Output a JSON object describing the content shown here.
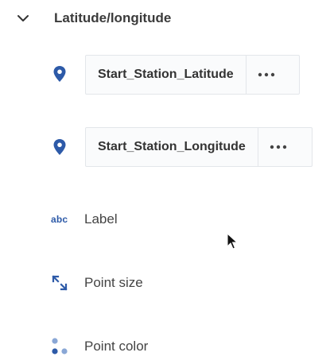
{
  "section": {
    "title": "Latitude/longitude",
    "expanded": true
  },
  "fields": [
    {
      "label": "Start_Station_Latitude",
      "icon": "location-pin-icon"
    },
    {
      "label": "Start_Station_Longitude",
      "icon": "location-pin-icon"
    }
  ],
  "encodings": {
    "label": {
      "icon_text": "abc",
      "text": "Label"
    },
    "point_size": {
      "text": "Point size",
      "icon": "resize-arrows-icon"
    },
    "point_color": {
      "text": "Point color",
      "icon": "color-dots-icon"
    }
  },
  "colors": {
    "accent": "#2d5aa8",
    "accent_light": "#8aa7d6",
    "chip_border": "#e3e6ea",
    "chip_bg": "#fafbfc"
  }
}
